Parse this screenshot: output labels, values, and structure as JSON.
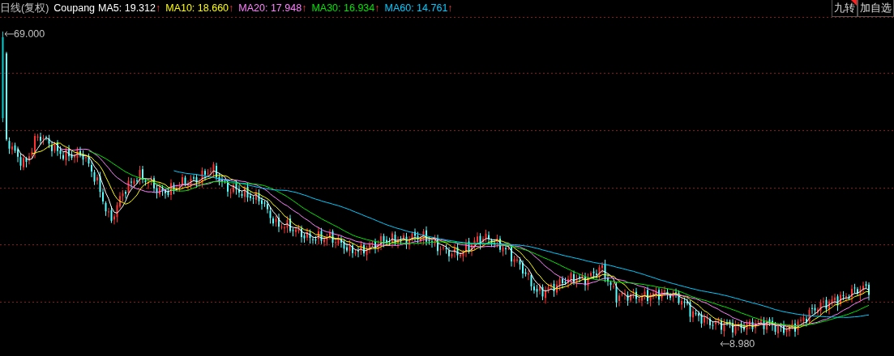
{
  "header": {
    "title": "日线(复权)",
    "symbol": "Coupang",
    "averages": [
      {
        "label": "MA5: 19.312",
        "arrow": "↑",
        "color": "#ffffff"
      },
      {
        "label": "MA10: 18.660",
        "arrow": "↑",
        "color": "#ffff00"
      },
      {
        "label": "MA20: 17.948",
        "arrow": "↑",
        "color": "#ff80ff"
      },
      {
        "label": "MA30: 16.934",
        "arrow": "↑",
        "color": "#00e600"
      },
      {
        "label": "MA60: 14.761",
        "arrow": "↑",
        "color": "#00ccff"
      }
    ]
  },
  "buttons": [
    {
      "label": "九转",
      "kind": "flagged"
    },
    {
      "label": "加自选",
      "kind": "plain"
    }
  ],
  "chart": {
    "max_label": "69.000",
    "min_label": "8.980"
  }
}
